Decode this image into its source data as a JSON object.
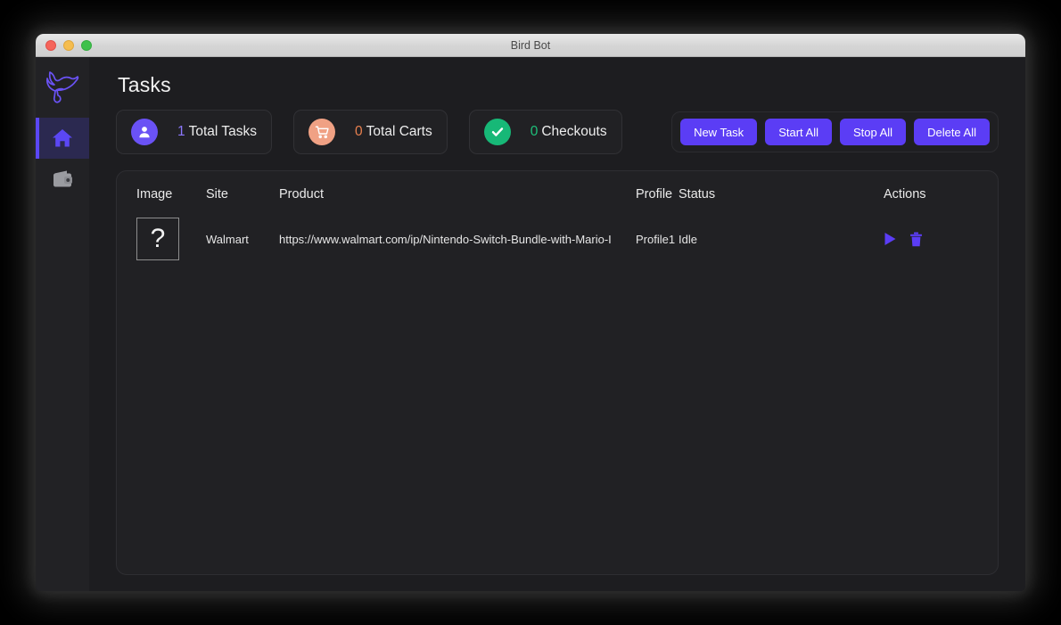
{
  "window": {
    "title": "Bird Bot",
    "traffic_lights": [
      "close",
      "minimize",
      "maximize"
    ]
  },
  "sidebar": {
    "logo_icon": "bird-logo-icon",
    "items": [
      {
        "icon": "home-icon",
        "name": "home",
        "active": true
      },
      {
        "icon": "wallet-icon",
        "name": "wallet",
        "active": false
      }
    ]
  },
  "main": {
    "page_title": "Tasks",
    "stats": [
      {
        "icon": "person-icon",
        "number": "1",
        "label": "Total Tasks",
        "accent": "#5b47f5",
        "circle": "#6a52f5"
      },
      {
        "icon": "cart-icon",
        "number": "0",
        "label": "Total Carts",
        "accent": "#e8804f",
        "circle": "#f0a184"
      },
      {
        "icon": "check-icon",
        "number": "0",
        "label": "Checkouts",
        "accent": "#1ec07a",
        "circle": "#17b877"
      }
    ],
    "buttons": [
      {
        "label": "New Task",
        "name": "new-task-button"
      },
      {
        "label": "Start All",
        "name": "start-all-button"
      },
      {
        "label": "Stop All",
        "name": "stop-all-button"
      },
      {
        "label": "Delete All",
        "name": "delete-all-button"
      }
    ],
    "table": {
      "columns": [
        "Image",
        "Site",
        "Product",
        "Profile",
        "Status",
        "Actions"
      ],
      "rows": [
        {
          "image_placeholder": "?",
          "site": "Walmart",
          "product": "https://www.walmart.com/ip/Nintendo-Switch-Bundle-with-Mario-I",
          "profile": "Profile1",
          "status": "Idle",
          "actions": [
            "start-task-icon",
            "delete-task-icon"
          ]
        }
      ]
    }
  },
  "colors": {
    "accent_purple": "#5b3df5",
    "background": "#1d1d20",
    "panel": "#212124",
    "sidebar": "#222225"
  }
}
